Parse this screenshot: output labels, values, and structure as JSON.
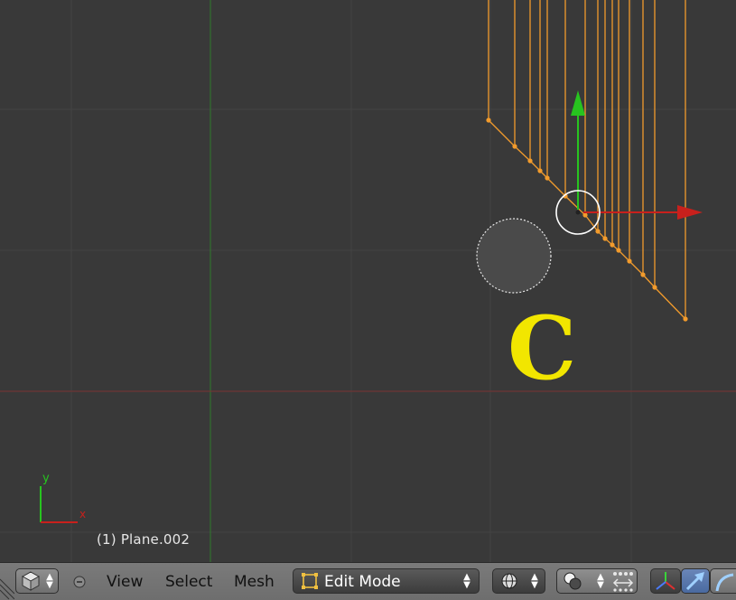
{
  "viewport": {
    "object_label": "(1) Plane.002",
    "overlay_letter": "C",
    "axis_labels": {
      "x": "x",
      "y": "y"
    },
    "colors": {
      "background": "#393939",
      "mesh": "#f29b2c",
      "x_axis": "#c8201c",
      "y_axis": "#27c41f",
      "overlay_letter": "#f2e600"
    }
  },
  "header": {
    "menu": {
      "view": "View",
      "select": "Select",
      "mesh": "Mesh"
    },
    "mode": "Edit Mode",
    "icons": [
      "cube-icon",
      "collapse-icon",
      "mode-icon",
      "pivot-globe-icon",
      "layers-icon",
      "manipulator-icon",
      "translate-icon",
      "rotate-icon"
    ]
  }
}
